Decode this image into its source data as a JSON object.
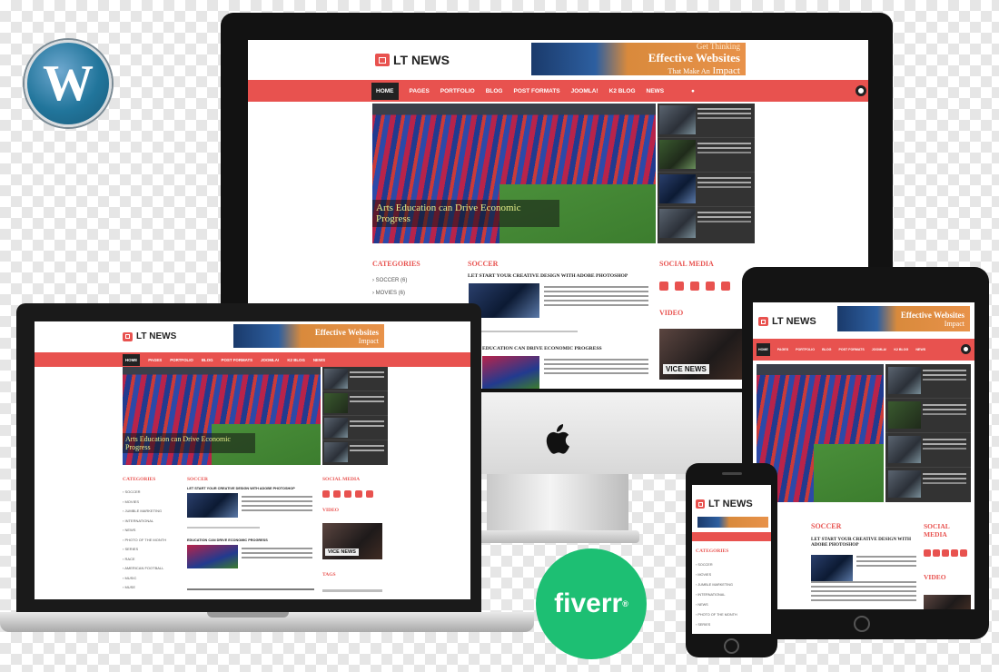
{
  "brand": {
    "site_name": "LT NEWS"
  },
  "banner": {
    "line1": "Get Thinking",
    "line2": "Effective Websites",
    "line3": "That Make An",
    "line4": "Impact"
  },
  "nav": {
    "items": [
      "HOME",
      "PAGES",
      "PORTFOLIO",
      "BLOG",
      "POST FORMATS",
      "JOOMLA!",
      "K2 BLOG",
      "NEWS"
    ]
  },
  "hero": {
    "caption": "Arts Education can Drive Economic Progress"
  },
  "sections": {
    "categories": "CATEGORIES",
    "soccer": "SOCCER",
    "social": "SOCIAL MEDIA",
    "video": "VIDEO",
    "tags": "TAGS"
  },
  "categories": [
    "SOCCER",
    "MOVIES",
    "JUMBLE MARKETING",
    "INTERNATIONAL",
    "NEWS",
    "PHOTO OF THE MONTH",
    "SERIES",
    "RACE",
    "AMERICAN FOOTBALL",
    "MUSIC",
    "MUSE"
  ],
  "articles": [
    {
      "title": "LET START YOUR CREATIVE DESIGN WITH ADOBE PHOTOSHOP"
    },
    {
      "title": "EDUCATION CAN DRIVE ECONOMIC PROGRESS"
    }
  ],
  "video_label": "VICE NEWS",
  "logos": {
    "wordpress": "W",
    "fiverr": "fiverr",
    "fiverr_mark": "®"
  },
  "colors": {
    "accent": "#e8524f",
    "dark": "#121212",
    "fiverr": "#1dbf73"
  }
}
